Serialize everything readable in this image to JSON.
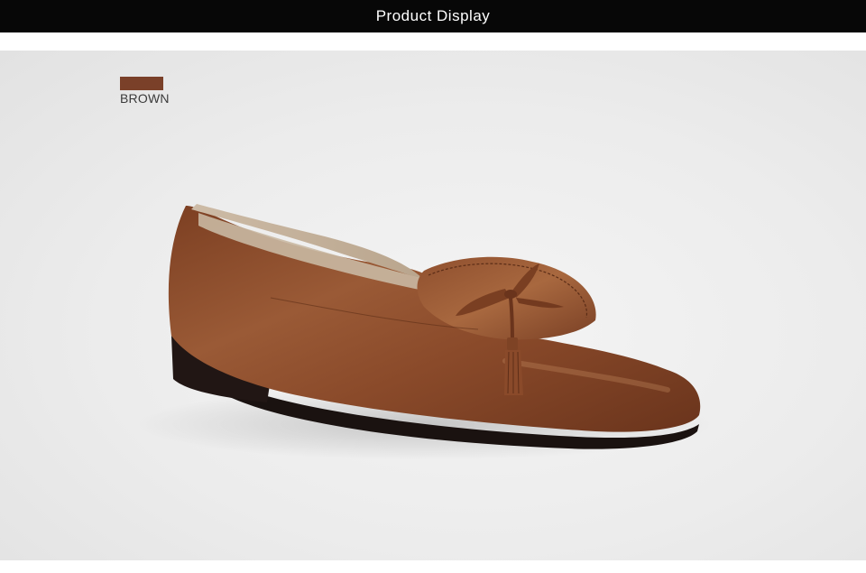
{
  "header": {
    "title": "Product Display"
  },
  "product": {
    "color_name": "BROWN",
    "color_hex": "#7a4029",
    "image_subject": "brown-leather-loafer"
  },
  "colors": {
    "header_bg": "#070707",
    "panel_bg": "#ececec",
    "leather": "#8a4a2a"
  }
}
